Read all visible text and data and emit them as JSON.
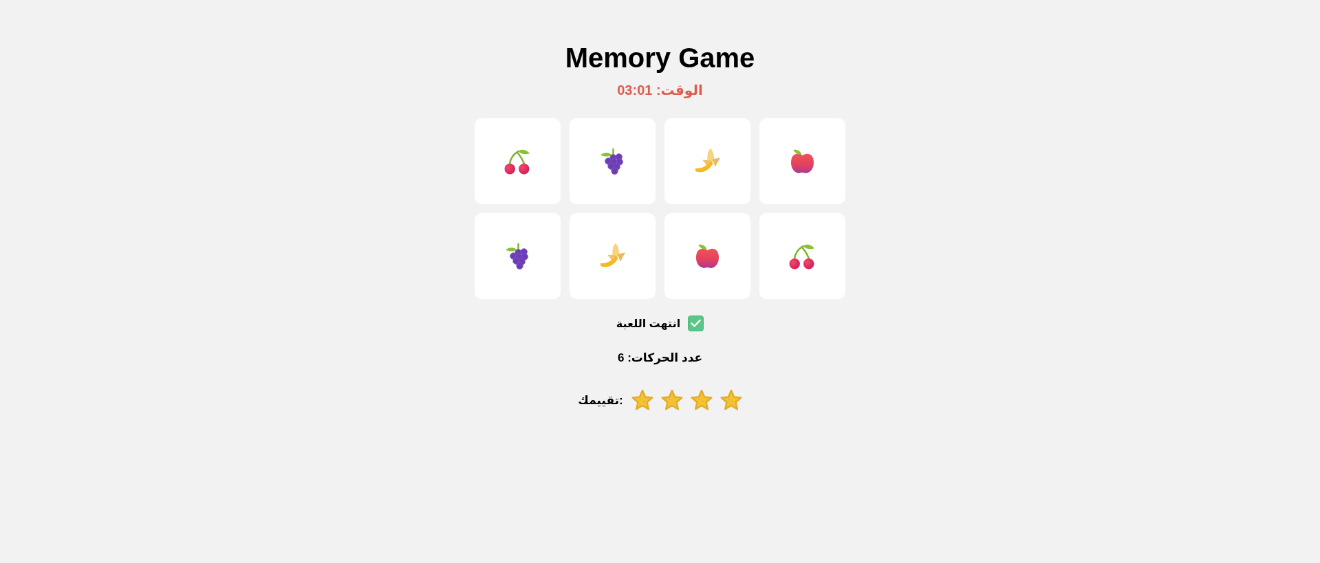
{
  "title": "Memory Game",
  "timer": "الوقت: 03:01",
  "cards": [
    {
      "kind": "cherry"
    },
    {
      "kind": "grapes"
    },
    {
      "kind": "banana"
    },
    {
      "kind": "apple"
    },
    {
      "kind": "grapes"
    },
    {
      "kind": "banana"
    },
    {
      "kind": "apple"
    },
    {
      "kind": "cherry"
    }
  ],
  "status": "انتهت اللعبة",
  "moves": "عدد الحركات: 6",
  "rating": {
    "label": "تقييمك:",
    "stars": 4
  }
}
